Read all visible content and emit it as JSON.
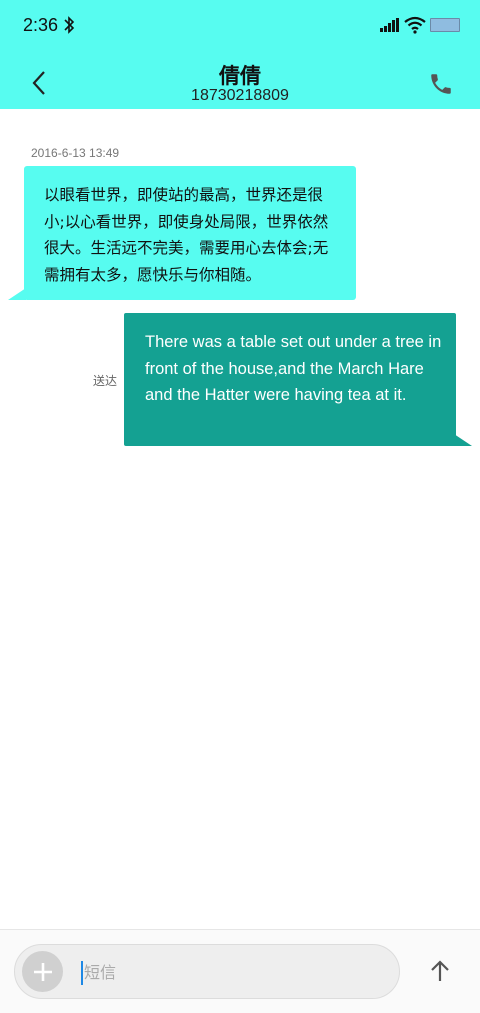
{
  "status_bar": {
    "time": "2:36",
    "icons": [
      "bluetooth-icon",
      "signal-icon",
      "wifi-icon",
      "battery-icon"
    ]
  },
  "header": {
    "contact_name": "倩倩",
    "contact_number": "18730218809",
    "back_icon": "chevron-left-icon",
    "call_icon": "phone-icon",
    "background_color": "#57fcf0"
  },
  "conversation": {
    "timestamp": "2016-6-13 13:49",
    "messages": [
      {
        "direction": "incoming",
        "text": "以眼看世界，即使站的最高，世界还是很小;以心看世界，即使身处局限，世界依然很大。生活远不完美，需要用心去体会;无需拥有太多，愿快乐与你相随。",
        "color": "#57fcf0"
      },
      {
        "direction": "outgoing",
        "status": "送达",
        "text": "There was a table set out under a tree in front of the house,and the March Hare and the Hatter were having tea at it.",
        "color": "#14a192"
      }
    ]
  },
  "composer": {
    "placeholder": "短信",
    "value": "",
    "add_icon": "plus-icon",
    "send_icon": "arrow-up-icon"
  }
}
